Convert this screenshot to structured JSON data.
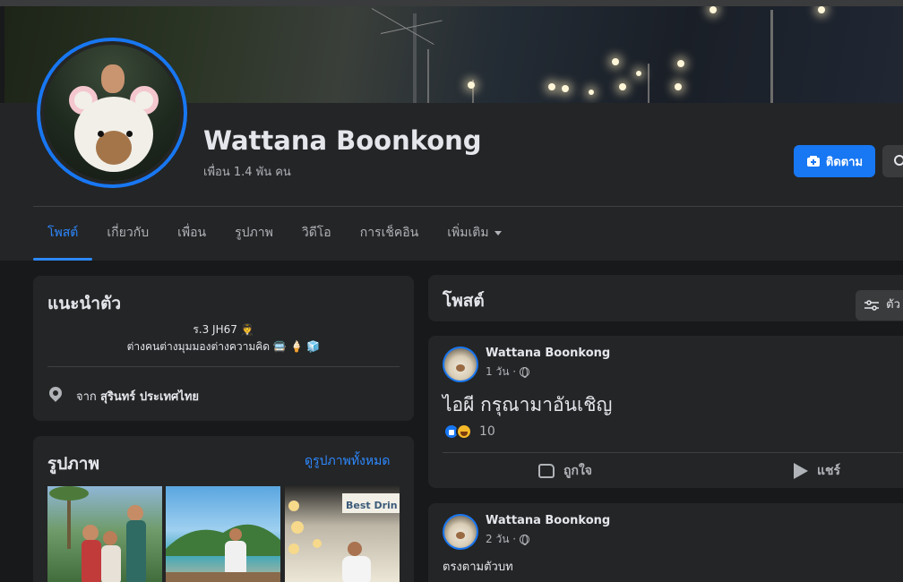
{
  "profile": {
    "name": "Wattana Boonkong",
    "friends": "เพื่อน 1.4 พัน คน",
    "follow_label": "ติดตาม"
  },
  "tabs": [
    {
      "label": "โพสต์"
    },
    {
      "label": "เกี่ยวกับ"
    },
    {
      "label": "เพื่อน"
    },
    {
      "label": "รูปภาพ"
    },
    {
      "label": "วิดีโอ"
    },
    {
      "label": "การเช็คอิน"
    },
    {
      "label": "เพิ่มเติม"
    }
  ],
  "intro": {
    "title": "แนะนำตัว",
    "bio_line1": "ร.3 JH67 🧑‍✈️",
    "bio_line2": "ต่างคนต่างมุมมองต่างความคิด 🚍 🍦 🧊",
    "location_prefix": "จาก",
    "location": "สุรินทร์ ประเทศไทย"
  },
  "photos": {
    "title": "รูปภาพ",
    "see_all": "ดูรูปภาพทั้งหมด",
    "sign_text": "Best Drin"
  },
  "posts_header": {
    "title": "โพสต์",
    "filter_label": "ตัว"
  },
  "posts": [
    {
      "author": "Wattana Boonkong",
      "time": "1 วัน ·",
      "text": "ไอผี กรุณามาอันเชิญ",
      "reaction_count": "10",
      "like_label": "ถูกใจ",
      "share_label": "แชร์"
    },
    {
      "author": "Wattana Boonkong",
      "time": "2 วัน ·",
      "text": "ตรงตามตัวบท"
    }
  ],
  "icons": {
    "follow": "add-friend-icon",
    "search": "search-icon",
    "location": "location-pin-icon",
    "filter": "filter-icon",
    "privacy": "globe-icon",
    "like": "thumbs-up-icon",
    "share": "share-arrow-icon"
  },
  "colors": {
    "accent": "#1877f2",
    "link": "#2d88ff",
    "background": "#18191a",
    "card": "#242526"
  }
}
